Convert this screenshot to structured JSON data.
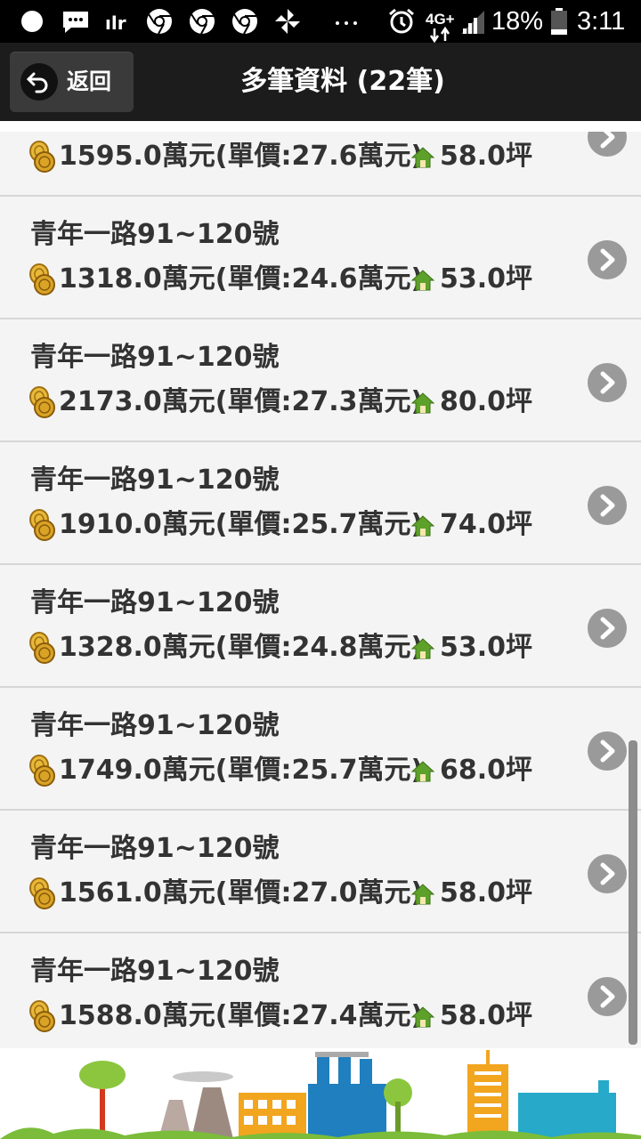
{
  "status_bar": {
    "battery": "18%",
    "time": "3:11",
    "network": "4G+"
  },
  "header": {
    "back_label": "返回",
    "title": "多筆資料 (22筆)"
  },
  "listings": [
    {
      "title": "",
      "price": "1595.0萬元(單價:27.6萬元)",
      "area": "58.0坪"
    },
    {
      "title": "青年一路91~120號",
      "price": "1318.0萬元(單價:24.6萬元)",
      "area": "53.0坪"
    },
    {
      "title": "青年一路91~120號",
      "price": "2173.0萬元(單價:27.3萬元)",
      "area": "80.0坪"
    },
    {
      "title": "青年一路91~120號",
      "price": "1910.0萬元(單價:25.7萬元)",
      "area": "74.0坪"
    },
    {
      "title": "青年一路91~120號",
      "price": "1328.0萬元(單價:24.8萬元)",
      "area": "53.0坪"
    },
    {
      "title": "青年一路91~120號",
      "price": "1749.0萬元(單價:25.7萬元)",
      "area": "68.0坪"
    },
    {
      "title": "青年一路91~120號",
      "price": "1561.0萬元(單價:27.0萬元)",
      "area": "58.0坪"
    },
    {
      "title": "青年一路91~120號",
      "price": "1588.0萬元(單價:27.4萬元)",
      "area": "58.0坪"
    }
  ],
  "icons": {
    "coin": "coin-stack-icon",
    "house": "house-icon",
    "chevron": "chevron-right-icon"
  },
  "colors": {
    "header_bg": "#1c1c1c",
    "list_bg": "#f4f4f4",
    "text": "#333333",
    "house_green": "#5da02a",
    "coin_gold": "#d9a326",
    "chevron_gray": "#9a9a9a"
  }
}
